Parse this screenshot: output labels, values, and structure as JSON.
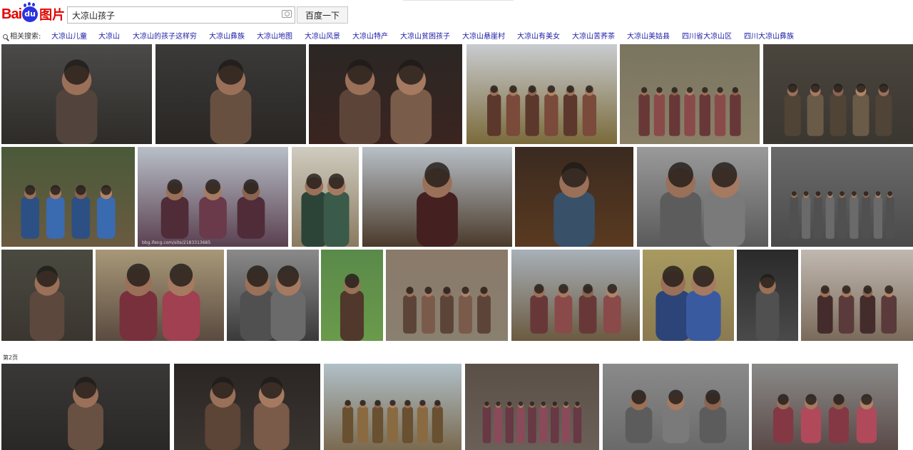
{
  "logo": {
    "bai": "Bai",
    "du": "du",
    "tu": "图片"
  },
  "search": {
    "query": "大凉山孩子",
    "button_label": "百度一下"
  },
  "related": {
    "label": "相关搜索:",
    "links": [
      "大凉山儿童",
      "大凉山",
      "大凉山的孩子这样穷",
      "大凉山彝族",
      "大凉山地图",
      "大凉山风景",
      "大凉山特产",
      "大凉山贫困孩子",
      "大凉山悬崖村",
      "大凉山有美女",
      "大凉山苦荞茶",
      "大凉山美姑县",
      "四川省大凉山区",
      "四川大凉山彝族"
    ]
  },
  "page2_label": "第2页",
  "watermark": "bbg.ifeng.com/site/2183313685",
  "images": [
    {
      "desc": "girl-closeup-dark",
      "sky": "#4a4a48",
      "ground": "#2e2b28",
      "kids": 1,
      "tone": "#6d5a50"
    },
    {
      "desc": "boy-eating-watermelon",
      "sky": "#3a3a38",
      "ground": "#2a2624",
      "kids": 1,
      "tone": "#8a6a55"
    },
    {
      "desc": "two-children-bottle",
      "sky": "#2b2724",
      "ground": "#3a2420",
      "kids": 2,
      "tone": "#7a5c4a"
    },
    {
      "desc": "children-mountain-field",
      "sky": "#c9ccd0",
      "ground": "#7a6a3a",
      "kids": 6,
      "tone": "#7a4a3a"
    },
    {
      "desc": "children-on-path-terraces",
      "sky": "#7a7560",
      "ground": "#8a8068",
      "kids": 7,
      "tone": "#8a4a4a"
    },
    {
      "desc": "children-by-stone-wall",
      "sky": "#4a463e",
      "ground": "#3a3630",
      "kids": 5,
      "tone": "#6a5a48"
    },
    {
      "desc": "kids-playing-ground",
      "sky": "#4a5a3a",
      "ground": "#6a5a40",
      "kids": 4,
      "tone": "#3a6ab0"
    },
    {
      "desc": "boy-arms-crossed",
      "sky": "#b8bfc8",
      "ground": "#5a4050",
      "kids": 3,
      "tone": "#6a3a4a"
    },
    {
      "desc": "boy-standing-wall",
      "sky": "#d0ccc0",
      "ground": "#8a7a60",
      "kids": 2,
      "tone": "#3a5a4a"
    },
    {
      "desc": "child-sitting-mountain",
      "sky": "#b8c0c8",
      "ground": "#4a3a2a",
      "kids": 1,
      "tone": "#5a2a2a"
    },
    {
      "desc": "child-standing-dark",
      "sky": "#3a2a20",
      "ground": "#5a3a20",
      "kids": 1,
      "tone": "#4a6a8a"
    },
    {
      "desc": "mother-child-bw",
      "sky": "#9a9a9a",
      "ground": "#5a5a5a",
      "kids": 2,
      "tone": "#7a7a7a"
    },
    {
      "desc": "group-children-bw",
      "sky": "#6a6a6a",
      "ground": "#4a4a4a",
      "kids": 9,
      "tone": "#6a6a6a"
    },
    {
      "desc": "child-held-by-adult",
      "sky": "#4a4a40",
      "ground": "#3a3530",
      "kids": 1,
      "tone": "#7a6050"
    },
    {
      "desc": "two-boys-wall",
      "sky": "#a89878",
      "ground": "#5a4a40",
      "kids": 2,
      "tone": "#a04050"
    },
    {
      "desc": "girl-carrying-baby-bw",
      "sky": "#8a8a8a",
      "ground": "#3a3a3a",
      "kids": 2,
      "tone": "#6a6a6a"
    },
    {
      "desc": "child-green-field",
      "sky": "#5a8a4a",
      "ground": "#6a9a4a",
      "kids": 1,
      "tone": "#6a4a3a"
    },
    {
      "desc": "children-carrying-loads",
      "sky": "#8a7a6a",
      "ground": "#8a8070",
      "kids": 5,
      "tone": "#7a5a4a"
    },
    {
      "desc": "children-by-trees",
      "sky": "#a8b0b8",
      "ground": "#6a5a40",
      "kids": 4,
      "tone": "#8a4a4a"
    },
    {
      "desc": "child-carrying-baby",
      "sky": "#a89a60",
      "ground": "#8a7a50",
      "kids": 2,
      "tone": "#3a5aa0"
    },
    {
      "desc": "child-sitting-dark-bw",
      "sky": "#2a2a2a",
      "ground": "#4a4a4a",
      "kids": 1,
      "tone": "#6a6a6a"
    },
    {
      "desc": "children-brick-wall",
      "sky": "#c0b8b0",
      "ground": "#7a6a5a",
      "kids": 4,
      "tone": "#5a3a3a"
    },
    {
      "desc": "boy-thinking",
      "sky": "#3a3836",
      "ground": "#2a2826",
      "kids": 1,
      "tone": "#8a6a58"
    },
    {
      "desc": "children-eating-dark",
      "sky": "#2a2624",
      "ground": "#3a3430",
      "kids": 2,
      "tone": "#7a5a48"
    },
    {
      "desc": "children-road-trees",
      "sky": "#b0c0c8",
      "ground": "#7a6a50",
      "kids": 7,
      "tone": "#8a6a40"
    },
    {
      "desc": "children-village-street",
      "sky": "#5a5048",
      "ground": "#6a6058",
      "kids": 9,
      "tone": "#8a4a5a"
    },
    {
      "desc": "elder-and-children-bw",
      "sky": "#8a8a8a",
      "ground": "#6a6a6a",
      "kids": 3,
      "tone": "#7a7a7a"
    },
    {
      "desc": "children-huddled-wall",
      "sky": "#8a8a88",
      "ground": "#5a4a48",
      "kids": 4,
      "tone": "#b04a5a"
    }
  ]
}
